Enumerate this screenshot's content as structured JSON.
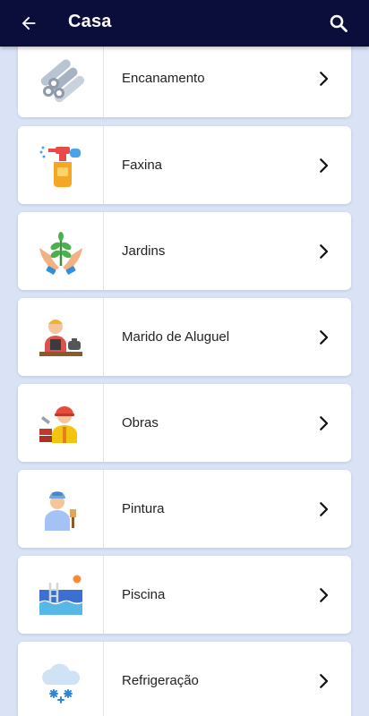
{
  "app_bar": {
    "title": "Casa",
    "back_icon": "arrow-left-icon",
    "search_icon": "search-icon",
    "background_color": "#0b0d3a"
  },
  "categories": [
    {
      "label": "Encanamento",
      "icon": "pipes-icon"
    },
    {
      "label": "Faxina",
      "icon": "spray-bottle-icon"
    },
    {
      "label": "Jardins",
      "icon": "plant-hands-icon"
    },
    {
      "label": "Marido de Aluguel",
      "icon": "handyman-icon"
    },
    {
      "label": "Obras",
      "icon": "construction-worker-icon"
    },
    {
      "label": "Pintura",
      "icon": "painter-icon"
    },
    {
      "label": "Piscina",
      "icon": "pool-icon"
    },
    {
      "label": "Refrigeração",
      "icon": "snow-cloud-icon"
    }
  ],
  "colors": {
    "page_background": "#d9e3f5",
    "card_background": "#ffffff"
  }
}
